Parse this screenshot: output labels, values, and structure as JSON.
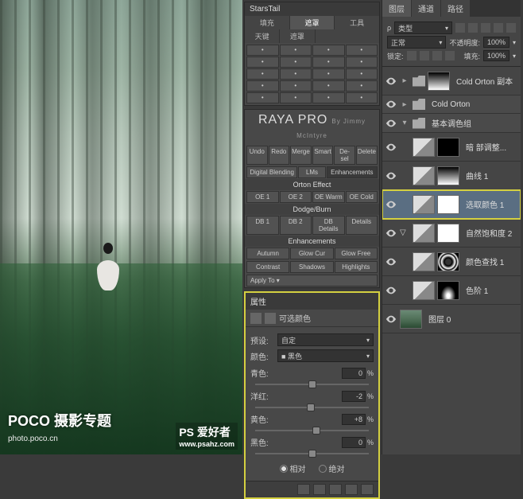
{
  "watermarks": {
    "poco_main": "POCO 摄影专题",
    "poco_url": "photo.poco.cn",
    "ps_main": "PS 爱好者",
    "ps_url": "www.psahz.com"
  },
  "starstail": {
    "title": "StarsTail",
    "tabs": [
      "填充",
      "遮罩",
      "工具"
    ],
    "row2": [
      "天键",
      "遮罩"
    ]
  },
  "raya": {
    "title": "RAYA PRO",
    "author": "By Jimmy McIntyre",
    "row1": [
      "Undo",
      "Redo",
      "Merge",
      "Smart",
      "De-sel",
      "Delete"
    ],
    "row2": [
      "Digital Blending",
      "LMs",
      "Enhancements"
    ],
    "orton_label": "Orton Effect",
    "orton": [
      "OE 1",
      "OE 2",
      "OE Warm",
      "OE Cold"
    ],
    "dodge_label": "Dodge/Burn",
    "dodge": [
      "DB 1",
      "DB 2",
      "DB Details",
      "Details"
    ],
    "enh_label": "Enhancements",
    "enh1": [
      "Autumn",
      "Glow Cur",
      "Glow Free"
    ],
    "enh2": [
      "Contrast",
      "Shadows",
      "Highlights"
    ],
    "apply": "Apply To"
  },
  "properties": {
    "panel_title": "属性",
    "adjustment_title": "可选颜色",
    "preset_label": "预设:",
    "preset_value": "自定",
    "color_label": "颜色:",
    "color_value": "黑色",
    "sliders": {
      "cyan_label": "青色:",
      "cyan_value": "0",
      "magenta_label": "洋红:",
      "magenta_value": "-2",
      "yellow_label": "黄色:",
      "yellow_value": "+8",
      "black_label": "黑色:",
      "black_value": "0"
    },
    "radio_relative": "相对",
    "radio_absolute": "绝对"
  },
  "layers": {
    "tab1": "图层",
    "tab2": "通道",
    "tab3": "路径",
    "kind_label": "类型",
    "blend_mode": "正常",
    "opacity_label": "不透明度:",
    "opacity_value": "100%",
    "lock_label": "锁定:",
    "fill_label": "填充:",
    "fill_value": "100%",
    "items": {
      "cold_orton_copy": "Cold Orton 副本",
      "cold_orton": "Cold Orton",
      "base_group": "基本调色组",
      "shadows_adj": "暗 部调整...",
      "curves": "曲线 1",
      "selective_color": "选取颜色 1",
      "vibrance": "自然饱和度 2",
      "color_lookup": "颜色查找 1",
      "levels": "色阶 1",
      "background": "图层 0"
    }
  }
}
